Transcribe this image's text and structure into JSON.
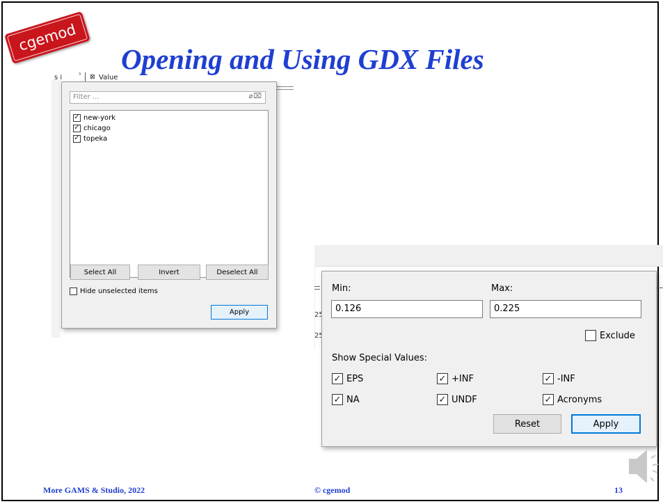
{
  "slide": {
    "badge": "cgemod",
    "title": "Opening and Using GDX Files",
    "footer_left": "More GAMS & Studio, 2022",
    "footer_center": "© cgemod",
    "page_number": "13"
  },
  "accent_color": "#1f3fd1",
  "badge_color": "#c9151c",
  "left_panel": {
    "header_col1": "s i",
    "header_col2": "Value",
    "filter_placeholder": "Filter ...",
    "items": [
      {
        "label": "new-york",
        "checked": true
      },
      {
        "label": "chicago",
        "checked": true
      },
      {
        "label": "topeka",
        "checked": true
      }
    ],
    "select_all": "Select All",
    "invert": "Invert",
    "deselect_all": "Deselect All",
    "hide_unselected": "Hide unselected items",
    "apply": "Apply"
  },
  "right_panel": {
    "min_label": "Min:",
    "max_label": "Max:",
    "min_value": "0.126",
    "max_value": "0.225",
    "exclude": "Exclude",
    "special_values_label": "Show Special Values:",
    "special": [
      {
        "label": "EPS",
        "checked": true
      },
      {
        "label": "+INF",
        "checked": true
      },
      {
        "label": "-INF",
        "checked": true
      },
      {
        "label": "NA",
        "checked": true
      },
      {
        "label": "UNDF",
        "checked": true
      },
      {
        "label": "Acronyms",
        "checked": true
      }
    ],
    "reset": "Reset",
    "apply": "Apply",
    "side_row1": "25",
    "side_row2": "25"
  }
}
